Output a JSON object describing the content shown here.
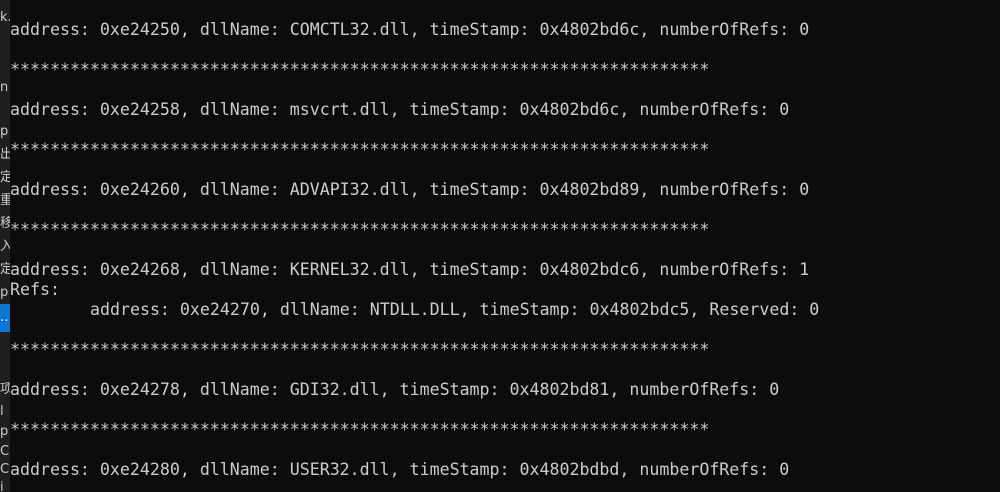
{
  "side_fragments": [
    "k.",
    "n",
    "p",
    "出",
    "定",
    "重",
    "移",
    "入",
    "定",
    "p",
    "…",
    "项",
    "l",
    "p",
    "C",
    "C",
    "i"
  ],
  "console": {
    "separator": "**********************************************************************",
    "lines": [
      "address: 0xe24250, dllName: COMCTL32.dll, timeStamp: 0x4802bd6c, numberOfRefs: 0",
      "address: 0xe24258, dllName: msvcrt.dll, timeStamp: 0x4802bd6c, numberOfRefs: 0",
      "address: 0xe24260, dllName: ADVAPI32.dll, timeStamp: 0x4802bd89, numberOfRefs: 0",
      "address: 0xe24268, dllName: KERNEL32.dll, timeStamp: 0x4802bdc6, numberOfRefs: 1",
      "Refs:",
      "address: 0xe24270, dllName: NTDLL.DLL, timeStamp: 0x4802bdc5, Reserved: 0",
      "address: 0xe24278, dllName: GDI32.dll, timeStamp: 0x4802bd81, numberOfRefs: 0",
      "address: 0xe24280, dllName: USER32.dll, timeStamp: 0x4802bdbd, numberOfRefs: 0"
    ]
  },
  "colors": {
    "background": "#0c0c0c",
    "text": "#cccccc",
    "side_panel": "#1f1f1f",
    "side_highlight": "#0a78d4"
  }
}
